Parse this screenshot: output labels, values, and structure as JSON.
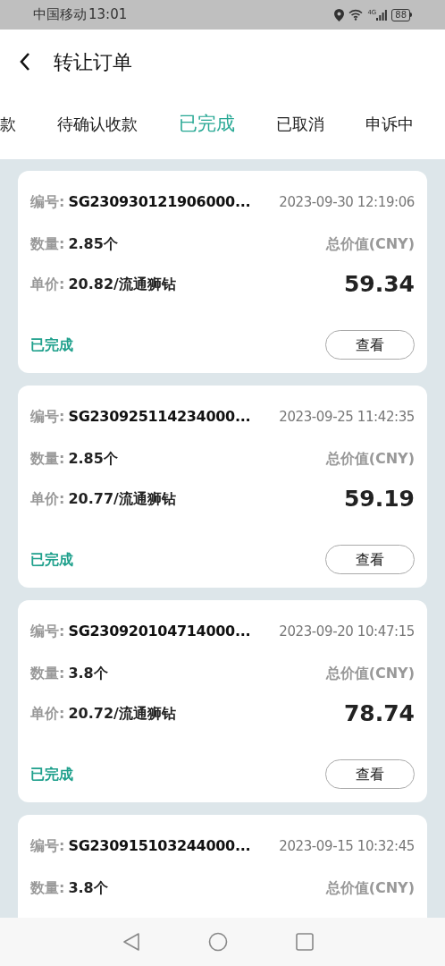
{
  "status_bar": {
    "carrier": "中国移动",
    "time": "13:01",
    "network": "4G",
    "battery": "88"
  },
  "header": {
    "title": "转让订单"
  },
  "tabs": [
    {
      "label": "款",
      "selected": false
    },
    {
      "label": "待确认收款",
      "selected": false
    },
    {
      "label": "已完成",
      "selected": true
    },
    {
      "label": "已取消",
      "selected": false
    },
    {
      "label": "申诉中",
      "selected": false
    }
  ],
  "orders": [
    {
      "number_label": "编号:",
      "number": "SG230930121906000...",
      "time": "2023-09-30 12:19:06",
      "quantity_label": "数量:",
      "quantity": "2.85个",
      "total_label": "总价值(CNY)",
      "price_label": "单价:",
      "price": "20.82/流通狮钻",
      "total": "59.34",
      "status": "已完成",
      "action": "查看"
    },
    {
      "number_label": "编号:",
      "number": "SG230925114234000...",
      "time": "2023-09-25 11:42:35",
      "quantity_label": "数量:",
      "quantity": "2.85个",
      "total_label": "总价值(CNY)",
      "price_label": "单价:",
      "price": "20.77/流通狮钻",
      "total": "59.19",
      "status": "已完成",
      "action": "查看"
    },
    {
      "number_label": "编号:",
      "number": "SG230920104714000...",
      "time": "2023-09-20 10:47:15",
      "quantity_label": "数量:",
      "quantity": "3.8个",
      "total_label": "总价值(CNY)",
      "price_label": "单价:",
      "price": "20.72/流通狮钻",
      "total": "78.74",
      "status": "已完成",
      "action": "查看"
    },
    {
      "number_label": "编号:",
      "number": "SG230915103244000...",
      "time": "2023-09-15 10:32:45",
      "quantity_label": "数量:",
      "quantity": "3.8个",
      "total_label": "总价值(CNY)"
    }
  ]
}
